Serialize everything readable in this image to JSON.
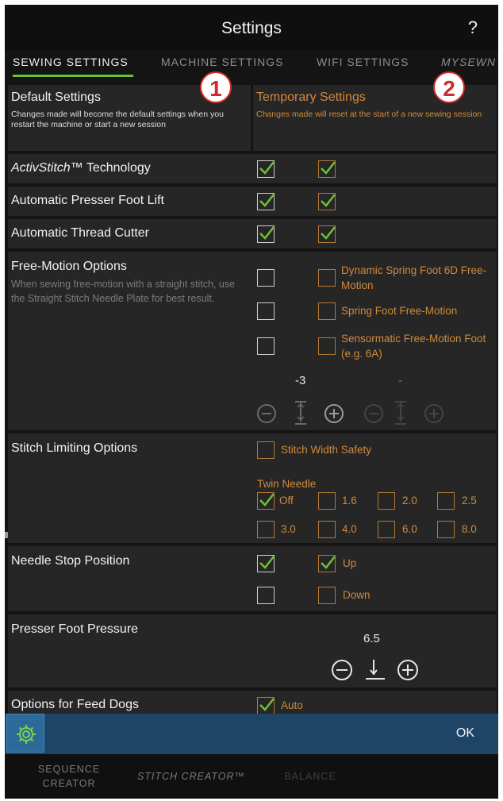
{
  "header": {
    "title": "Settings",
    "help": "?"
  },
  "tabs": [
    {
      "label": "SEWING SETTINGS",
      "active": true
    },
    {
      "label": "MACHINE SETTINGS"
    },
    {
      "label": "WIFI SETTINGS"
    },
    {
      "label": "MYSEWN"
    }
  ],
  "callouts": [
    "1",
    "2"
  ],
  "columns": {
    "default": {
      "title": "Default Settings",
      "desc": "Changes made will become the default settings when you restart the machine or start a new session"
    },
    "temporary": {
      "title": "Temporary Settings",
      "desc": "Changes made will reset at the start of a new sewing session"
    }
  },
  "rows": {
    "activstitch": {
      "label_italic": "ActivStitch",
      "label_rest": "™ Technology",
      "default": true,
      "temporary": true
    },
    "presser_lift": {
      "label": "Automatic Presser Foot Lift",
      "default": true,
      "temporary": true
    },
    "thread_cutter": {
      "label": "Automatic Thread Cutter",
      "default": true,
      "temporary": true
    },
    "free_motion": {
      "label": "Free-Motion Options",
      "desc": "When sewing free-motion with a straight stitch, use the Straight Stitch Needle Plate for best result.",
      "options": [
        {
          "label": "Dynamic Spring Foot 6D Free-Motion",
          "default": false,
          "temporary": false
        },
        {
          "label": "Spring Foot Free-Motion",
          "default": false,
          "temporary": false
        },
        {
          "label": "Sensormatic Free-Motion Foot (e.g. 6A)",
          "default": false,
          "temporary": false
        }
      ],
      "height_default": "-3",
      "height_temporary": "-"
    },
    "stitch_limiting": {
      "label": "Stitch Limiting Options",
      "width_safety": "Stitch Width Safety",
      "twin_needle_label": "Twin Needle",
      "twin_needle_options": [
        {
          "label": "Off",
          "checked": true
        },
        {
          "label": "1.6",
          "checked": false
        },
        {
          "label": "2.0",
          "checked": false
        },
        {
          "label": "2.5",
          "checked": false
        },
        {
          "label": "3.0",
          "checked": false
        },
        {
          "label": "4.0",
          "checked": false
        },
        {
          "label": "6.0",
          "checked": false
        },
        {
          "label": "8.0",
          "checked": false
        }
      ]
    },
    "needle_stop": {
      "label": "Needle Stop Position",
      "up": "Up",
      "down": "Down",
      "default_up": true,
      "temporary_up": true
    },
    "presser_pressure": {
      "label": "Presser Foot Pressure",
      "value": "6.5"
    },
    "feed_dogs": {
      "label": "Options for Feed Dogs",
      "auto": "Auto",
      "checked": true
    }
  },
  "bottombar": {
    "ok": "OK"
  },
  "footer": {
    "sequence_line1": "SEQUENCE",
    "sequence_line2": "CREATOR",
    "stitch_creator": "STITCH CREATOR™",
    "balance": "BALANCE"
  },
  "colors": {
    "accent_green": "#6fbf3a",
    "orange": "#d1893c",
    "bar_blue": "#1f4566",
    "callout_red": "#cc2c2c"
  },
  "icons": [
    "help-icon",
    "check-icon",
    "minus-circle-icon",
    "plus-circle-icon",
    "presser-foot-height-icon",
    "presser-foot-pressure-icon",
    "gear-icon"
  ]
}
